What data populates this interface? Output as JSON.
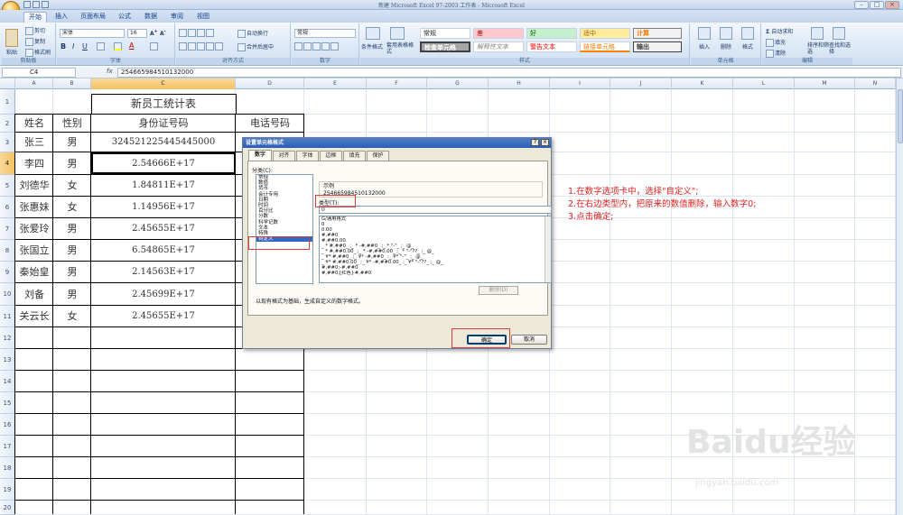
{
  "window": {
    "title": "新建 Microsoft Excel 97-2003 工作表 - Microsoft Excel",
    "controls": [
      "–",
      "□",
      "×"
    ]
  },
  "tabs": [
    "开始",
    "插入",
    "页面布局",
    "公式",
    "数据",
    "审阅",
    "视图"
  ],
  "ribbon": {
    "clipboard": {
      "paste": "粘贴",
      "cut": "剪切",
      "copy": "复制",
      "format_painter": "格式刷",
      "label": "剪贴板"
    },
    "font": {
      "name": "宋体",
      "size": "16",
      "label": "字体"
    },
    "alignment": {
      "wrap": "自动换行",
      "merge": "合并后居中",
      "label": "对齐方式"
    },
    "number": {
      "format": "常规",
      "label": "数字"
    },
    "styles": {
      "conditional": "条件格式",
      "table_format": "套用表格格式",
      "check_cell": "检查单元格",
      "cells": [
        "常规",
        "差",
        "好",
        "适中",
        "计算",
        "检查单元格",
        "解释性文本",
        "警告文本",
        "链接单元格",
        "输出"
      ],
      "label": "样式"
    },
    "cells": {
      "insert": "插入",
      "delete": "删除",
      "format": "格式",
      "label": "单元格"
    },
    "editing": {
      "autosum": "自动求和",
      "fill": "填充",
      "clear": "清除",
      "sort": "排序和筛选",
      "find": "查找和选择",
      "label": "编辑"
    },
    "colors": {
      "bad": "#ffc7ce",
      "good": "#c6efce",
      "neutral": "#ffeb9c",
      "calc": "#f2f2f2",
      "check": "#a5a5a5"
    }
  },
  "formula_bar": {
    "name_box": "C4",
    "fx": "fx",
    "value": "254665984510132000"
  },
  "columns": [
    "A",
    "B",
    "C",
    "D",
    "E",
    "F",
    "G",
    "H",
    "I",
    "J",
    "K",
    "L",
    "M",
    "N"
  ],
  "rows": [
    "1",
    "2",
    "3",
    "4",
    "5",
    "6",
    "7",
    "8",
    "9",
    "10",
    "11",
    "12",
    "13",
    "14",
    "15",
    "16",
    "17",
    "18",
    "19",
    "20"
  ],
  "sheet": {
    "title": "新员工统计表",
    "headers": [
      "姓名",
      "性别",
      "身份证号码",
      "电话号码"
    ],
    "records": [
      [
        "张三",
        "男",
        "324521225445445000"
      ],
      [
        "李四",
        "男",
        "2.54666E+17"
      ],
      [
        "刘德华",
        "女",
        "1.84811E+17"
      ],
      [
        "张惠妹",
        "女",
        "1.14956E+17"
      ],
      [
        "张爱玲",
        "男",
        "2.45655E+17"
      ],
      [
        "张国立",
        "男",
        "6.54865E+17"
      ],
      [
        "秦始皇",
        "男",
        "2.14563E+17"
      ],
      [
        "刘备",
        "男",
        "2.45699E+17"
      ],
      [
        "关云长",
        "女",
        "2.45655E+17"
      ]
    ]
  },
  "dialog": {
    "title": "设置单元格格式",
    "help": "?",
    "close": "×",
    "tabs": [
      "数字",
      "对齐",
      "字体",
      "边框",
      "填充",
      "保护"
    ],
    "category_label": "分类(C):",
    "categories": [
      "常规",
      "数值",
      "货币",
      "会计专用",
      "日期",
      "时间",
      "百分比",
      "分数",
      "科学记数",
      "文本",
      "特殊",
      "自定义"
    ],
    "sample_label": "示例",
    "sample_value": "254665984510132000",
    "type_label": "类型(T):",
    "type_value": "0",
    "type_list": [
      "G/通用格式",
      "0",
      "0.00",
      "#,##0",
      "#,##0.00",
      "_ * #,##0_ ;_ * -#,##0_ ;_ * \"-\"_ ;_ @_",
      "_ * #,##0.00_ ;_ * -#,##0.00_ ;_ * \"-\"??_ ;_ @_",
      "_ ¥* #,##0_ ;_ ¥* -#,##0_ ;_ ¥* \"-\"_ ;_ @_",
      "_ ¥* #,##0.00_ ;_ ¥* -#,##0.00_ ;_ ¥* \"-\"??_ ;_ @_",
      "#,##0;-#,##0",
      "#,##0;[红色]-#,##0"
    ],
    "delete": "删除(D)",
    "description": "以现有格式为基础，生成自定义的数字格式。",
    "ok": "确定",
    "cancel": "取消"
  },
  "notes": [
    "1.在数字选项卡中，选择\"自定义\";",
    "2.在右边类型内，把原来的数值删除，输入数字0;",
    "3.点击确定;"
  ],
  "watermark": {
    "logo": "Baidu经验",
    "url": "jingyan.baidu.com"
  }
}
